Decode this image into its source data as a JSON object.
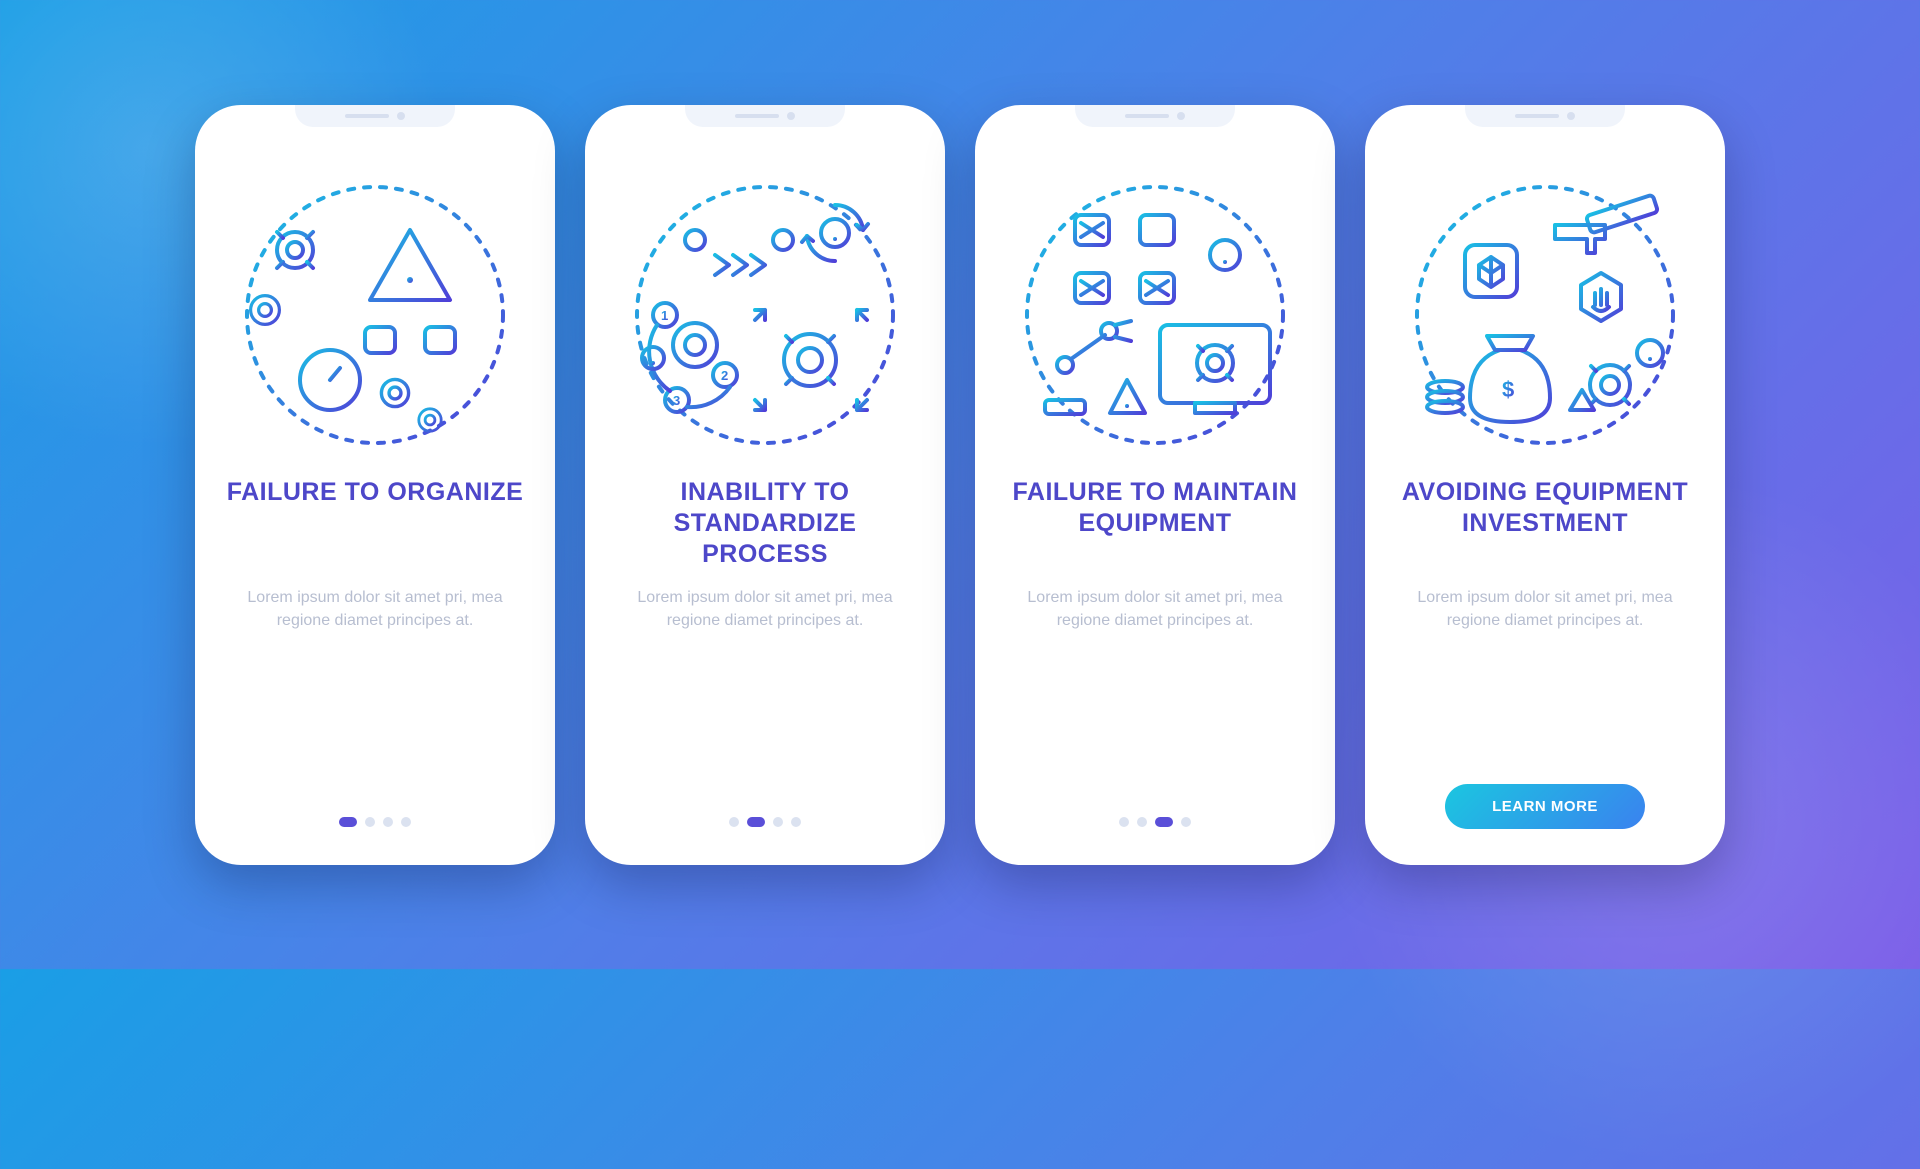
{
  "screens": [
    {
      "title": "FAILURE TO ORGANIZE",
      "desc": "Lorem ipsum dolor sit amet pri, mea regione diamet principes at.",
      "active_dot": 0,
      "dot_count": 4
    },
    {
      "title": "INABILITY TO STANDARDIZE PROCESS",
      "desc": "Lorem ipsum dolor sit amet pri, mea regione diamet principes at.",
      "active_dot": 1,
      "dot_count": 4
    },
    {
      "title": "FAILURE TO MAINTAIN EQUIPMENT",
      "desc": "Lorem ipsum dolor sit amet pri, mea regione diamet principes at.",
      "active_dot": 2,
      "dot_count": 4
    },
    {
      "title": "AVOIDING EQUIPMENT INVESTMENT",
      "desc": "Lorem ipsum dolor sit amet pri, mea regione diamet principes at.",
      "cta_label": "LEARN MORE"
    }
  ]
}
